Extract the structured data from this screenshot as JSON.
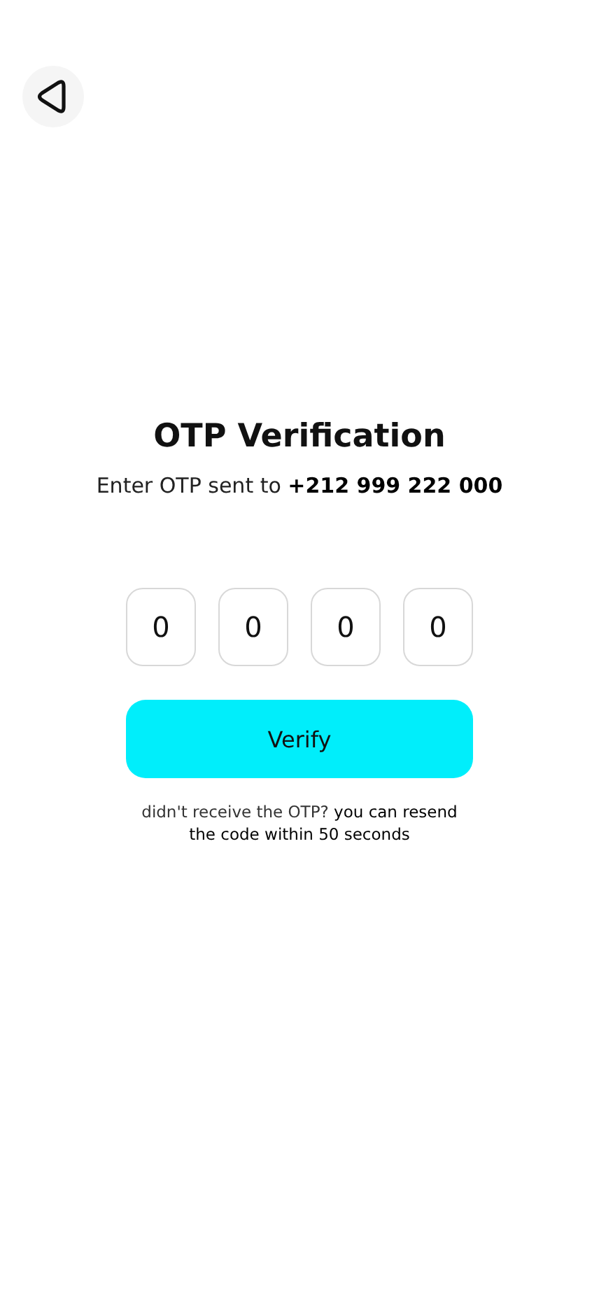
{
  "title": "OTP Verification",
  "subtitle": "Enter OTP sent to **+212 999 222 000**",
  "otp_digits": [
    "0",
    "0",
    "0",
    "0"
  ],
  "verify_button": "Verify",
  "resend_note": "didn't receive the OTP? **you can resend the code within 50 seconds**"
}
